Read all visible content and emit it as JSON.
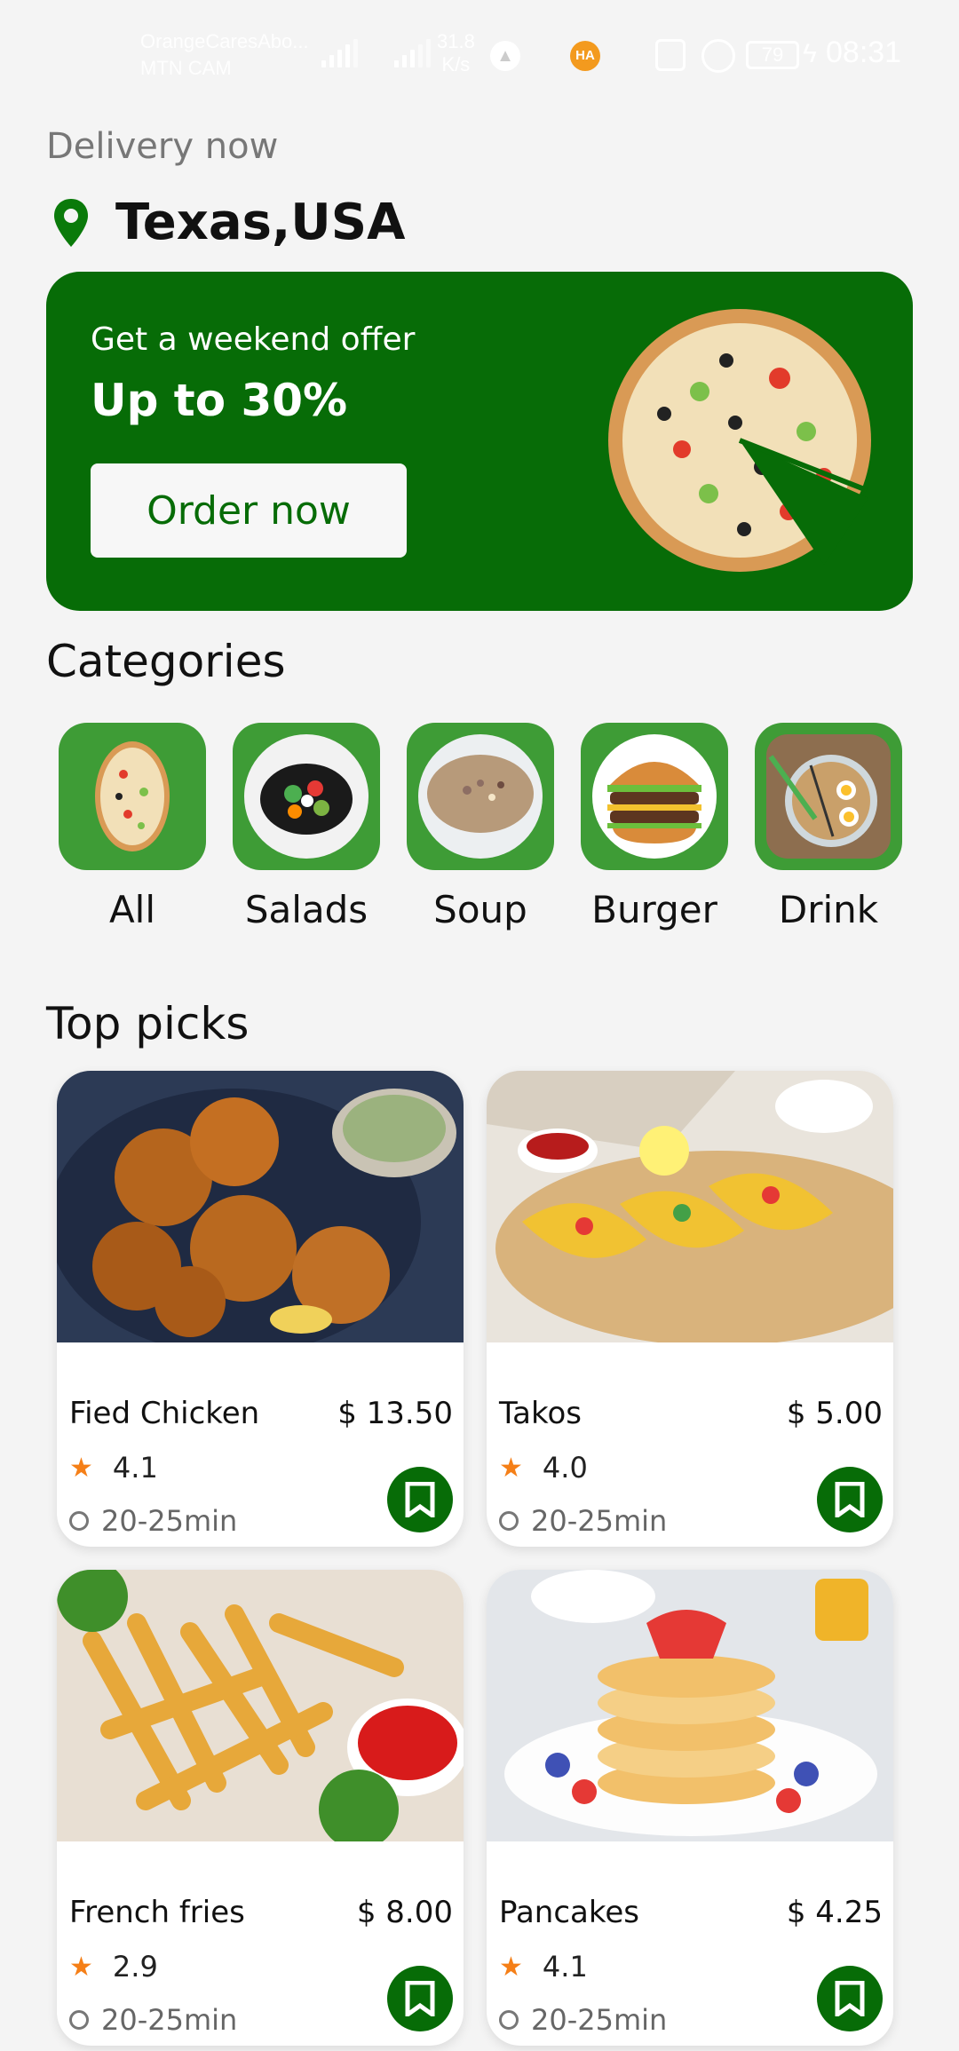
{
  "status_bar": {
    "carrier_line1": "OrangeCaresAbo...",
    "carrier_line2": "MTN CAM",
    "speed_value": "31.8",
    "speed_unit": "K/s",
    "ha_badge": "HA",
    "battery": "79",
    "time": "08:31"
  },
  "header": {
    "delivery_label": "Delivery now",
    "location": "Texas,USA"
  },
  "banner": {
    "subtitle": "Get a weekend offer",
    "headline": "Up to 30%",
    "button_label": "Order now"
  },
  "categories": {
    "title": "Categories",
    "items": [
      {
        "label": "All"
      },
      {
        "label": "Salads"
      },
      {
        "label": "Soup"
      },
      {
        "label": "Burger"
      },
      {
        "label": "Drink"
      }
    ]
  },
  "top_picks": {
    "title": "Top picks",
    "items": [
      {
        "name": "Fied Chicken",
        "price": "$ 13.50",
        "rating": "4.1",
        "time": "20-25min"
      },
      {
        "name": "Takos",
        "price": "$ 5.00",
        "rating": "4.0",
        "time": "20-25min"
      },
      {
        "name": "French fries",
        "price": "$ 8.00",
        "rating": "2.9",
        "time": "20-25min"
      },
      {
        "name": "Pancakes",
        "price": "$ 4.25",
        "rating": "4.1",
        "time": "20-25min"
      }
    ]
  },
  "colors": {
    "primary_green": "#076c07",
    "tile_green": "#3e9c36",
    "star_orange": "#f57f17",
    "background": "#f4f4f4"
  }
}
